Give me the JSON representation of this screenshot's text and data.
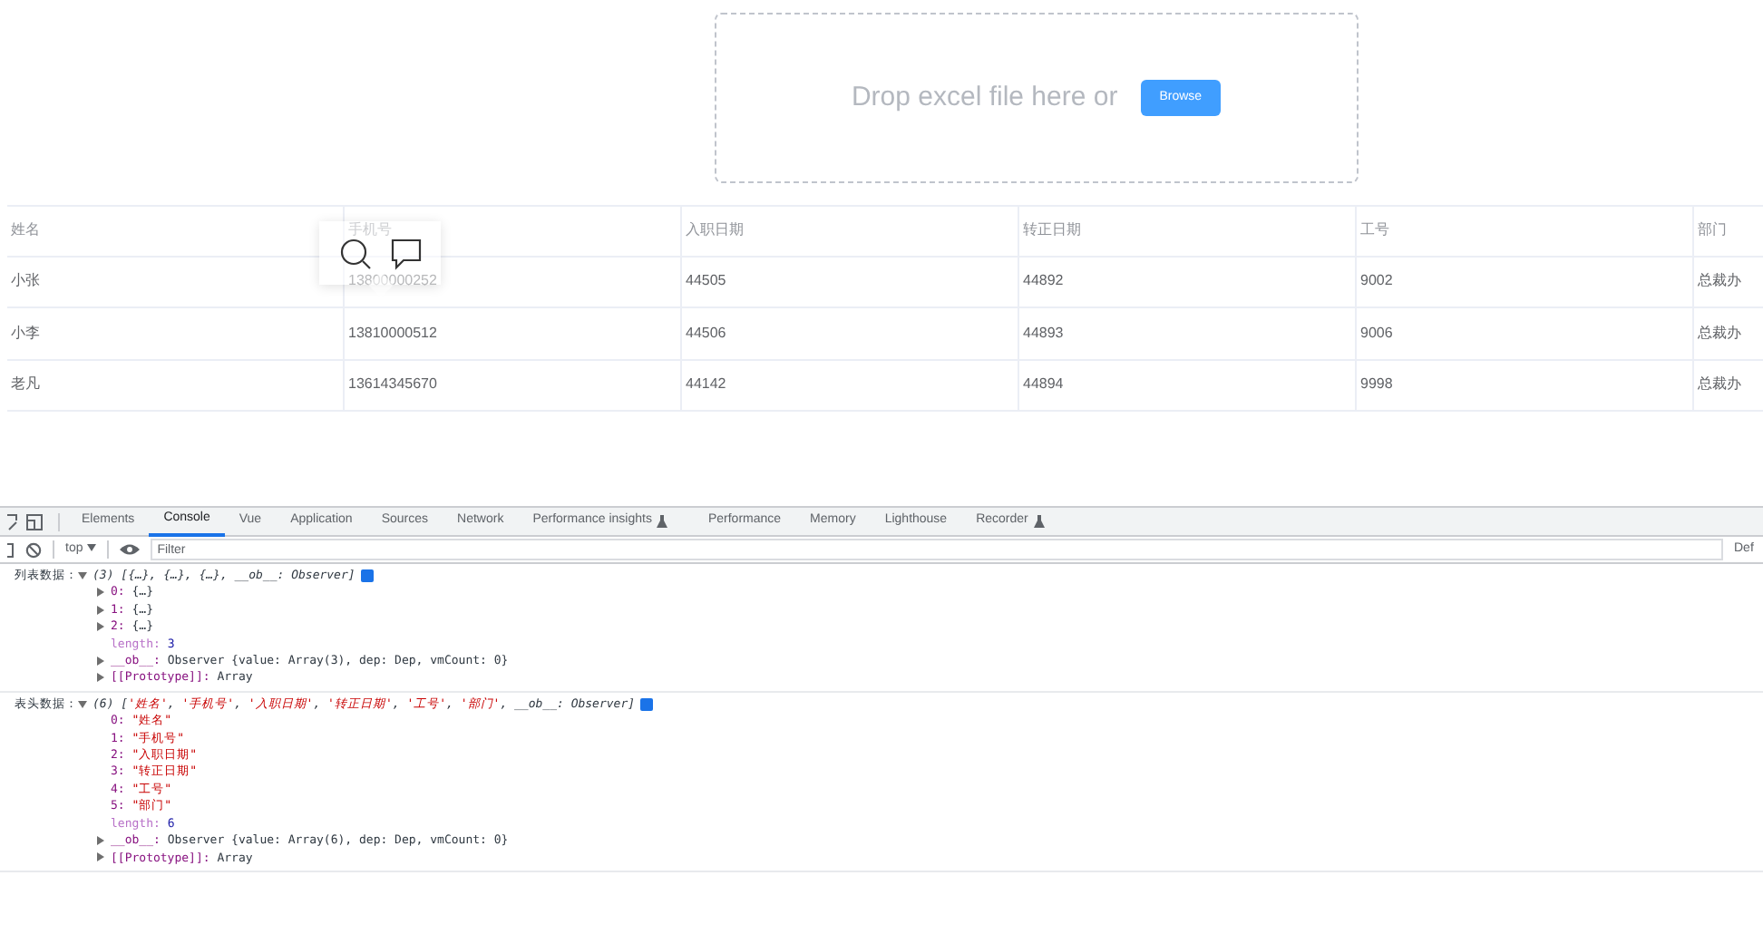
{
  "upload": {
    "prompt": "Drop excel file here or",
    "button": "Browse"
  },
  "table": {
    "columns": [
      "姓名",
      "手机号",
      "入职日期",
      "转正日期",
      "工号",
      "部门"
    ],
    "rows": [
      [
        "小张",
        "13800000252",
        "44505",
        "44892",
        "9002",
        "总裁办"
      ],
      [
        "小李",
        "13810000512",
        "44506",
        "44893",
        "9006",
        "总裁办"
      ],
      [
        "老凡",
        "13614345670",
        "44142",
        "44894",
        "9998",
        "总裁办"
      ]
    ]
  },
  "devtools": {
    "tabs": [
      {
        "label": "Elements",
        "selected": false,
        "experimental": false
      },
      {
        "label": "Console",
        "selected": true,
        "experimental": false
      },
      {
        "label": "Vue",
        "selected": false,
        "experimental": false
      },
      {
        "label": "Application",
        "selected": false,
        "experimental": false
      },
      {
        "label": "Sources",
        "selected": false,
        "experimental": false
      },
      {
        "label": "Network",
        "selected": false,
        "experimental": false
      },
      {
        "label": "Performance insights",
        "selected": false,
        "experimental": true
      },
      {
        "label": "Performance",
        "selected": false,
        "experimental": false
      },
      {
        "label": "Memory",
        "selected": false,
        "experimental": false
      },
      {
        "label": "Lighthouse",
        "selected": false,
        "experimental": false
      },
      {
        "label": "Recorder",
        "selected": false,
        "experimental": true
      }
    ],
    "context": "top",
    "filter_placeholder": "Filter",
    "levels": "Def"
  },
  "console": [
    {
      "label": "列表数据：",
      "expanded": true,
      "count": "(3)",
      "summary": [
        {
          "kind": "plain",
          "text": "[{…}, {…}, {…}, __ob__: Observer]"
        }
      ],
      "lines": [
        {
          "kind": "object",
          "key": "0:",
          "value": "{…}"
        },
        {
          "kind": "object",
          "key": "1:",
          "value": "{…}"
        },
        {
          "kind": "object",
          "key": "2:",
          "value": "{…}"
        },
        {
          "kind": "number",
          "key": "length:",
          "value": "3"
        },
        {
          "kind": "object",
          "key": "__ob__:",
          "value": "Observer {value: Array(3), dep: Dep, vmCount: 0}"
        },
        {
          "kind": "object",
          "key": "[[Prototype]]:",
          "value": "Array"
        }
      ]
    },
    {
      "label": "表头数据：",
      "expanded": true,
      "count": "(6)",
      "summary": [
        {
          "kind": "plain",
          "text": "["
        },
        {
          "kind": "string",
          "text": "'姓名'"
        },
        {
          "kind": "plain",
          "text": ", "
        },
        {
          "kind": "string",
          "text": "'手机号'"
        },
        {
          "kind": "plain",
          "text": ", "
        },
        {
          "kind": "string",
          "text": "'入职日期'"
        },
        {
          "kind": "plain",
          "text": ", "
        },
        {
          "kind": "string",
          "text": "'转正日期'"
        },
        {
          "kind": "plain",
          "text": ", "
        },
        {
          "kind": "string",
          "text": "'工号'"
        },
        {
          "kind": "plain",
          "text": ", "
        },
        {
          "kind": "string",
          "text": "'部门'"
        },
        {
          "kind": "plain",
          "text": ", __ob__: Observer]"
        }
      ],
      "lines": [
        {
          "kind": "string",
          "key": "0:",
          "value": "\"姓名\""
        },
        {
          "kind": "string",
          "key": "1:",
          "value": "\"手机号\""
        },
        {
          "kind": "string",
          "key": "2:",
          "value": "\"入职日期\""
        },
        {
          "kind": "string",
          "key": "3:",
          "value": "\"转正日期\""
        },
        {
          "kind": "string",
          "key": "4:",
          "value": "\"工号\""
        },
        {
          "kind": "string",
          "key": "5:",
          "value": "\"部门\""
        },
        {
          "kind": "number",
          "key": "length:",
          "value": "6"
        },
        {
          "kind": "object",
          "key": "__ob__:",
          "value": "Observer {value: Array(6), dep: Dep, vmCount: 0}"
        },
        {
          "kind": "object",
          "key": "[[Prototype]]:",
          "value": "Array"
        }
      ]
    }
  ]
}
